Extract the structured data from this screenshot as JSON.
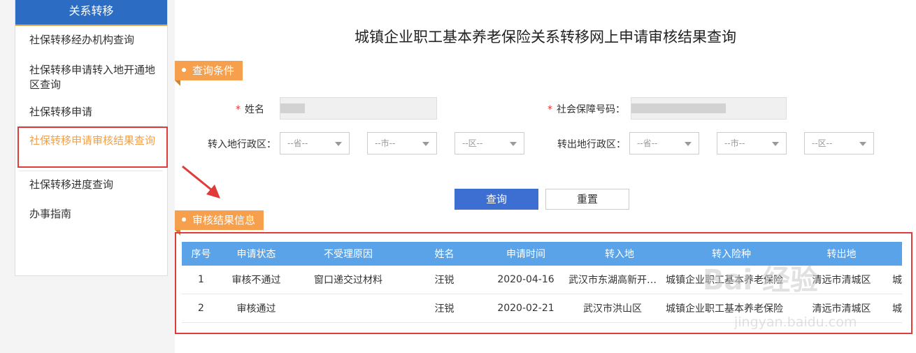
{
  "sidebar": {
    "title": "关系转移",
    "items": [
      {
        "label": "社保转移经办机构查询"
      },
      {
        "label": "社保转移申请转入地开通地区查询"
      },
      {
        "label": "社保转移申请"
      },
      {
        "label": "社保转移申请审核结果查询"
      },
      {
        "label": "社保转移进度查询"
      },
      {
        "label": "办事指南"
      }
    ]
  },
  "page": {
    "title": "城镇企业职工基本养老保险关系转移网上申请审核结果查询"
  },
  "query": {
    "section_label": "查询条件",
    "required_mark": "*",
    "name_label": "姓名",
    "ssn_label": "社会保障号码：",
    "in_region_label": "转入地行政区：",
    "out_region_label": "转出地行政区：",
    "province_placeholder": "--省--",
    "city_placeholder": "--市--",
    "district_placeholder": "--区--",
    "search_label": "查询",
    "reset_label": "重置"
  },
  "results": {
    "section_label": "审核结果信息",
    "columns": [
      "序号",
      "申请状态",
      "不受理原因",
      "姓名",
      "申请时间",
      "转入地",
      "转入险种",
      "转出地"
    ],
    "rows": [
      [
        "1",
        "审核不通过",
        "窗口递交过材料",
        "汪锐",
        "2020-04-16",
        "武汉市东湖高新开…",
        "城镇企业职工基本养老保险",
        "清远市清城区",
        "城"
      ],
      [
        "2",
        "审核通过",
        "",
        "汪锐",
        "2020-02-21",
        "武汉市洪山区",
        "城镇企业职工基本养老保险",
        "清远市清城区",
        "城"
      ]
    ]
  },
  "watermark": {
    "logo": "Bai 经验",
    "url": "jingyan.baidu.com"
  },
  "colors": {
    "primary": "#3d6fd3",
    "accent": "#f6a04d",
    "header": "#5aa3e8",
    "highlight": "#e03a3a"
  }
}
